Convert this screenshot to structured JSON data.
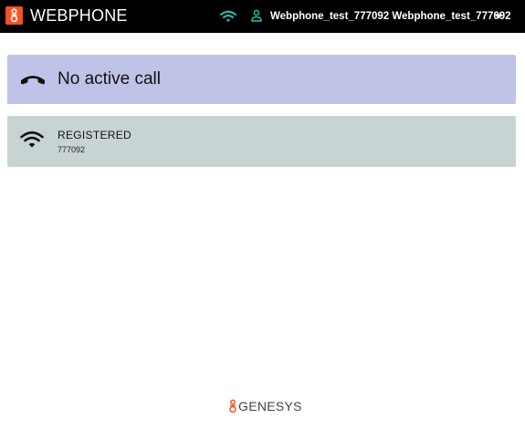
{
  "header": {
    "app_title": "WEBPHONE",
    "user_display": "Webphone_test_777092 Webphone_test_777092",
    "icons": [
      "genesys-logo-icon",
      "wifi-icon",
      "person-icon",
      "caret-down-icon"
    ],
    "colors": {
      "bar_bg": "#000000",
      "logo_bg": "#ff4f1f",
      "accent_teal": "#1ec8b4"
    }
  },
  "call_card": {
    "status": "No active call",
    "icon": "phone-hangup-icon",
    "color": "#c0c3e8"
  },
  "registration_card": {
    "status": "REGISTERED",
    "number": "777092",
    "icon": "wifi-icon",
    "color": "#c8d4d4"
  },
  "footer": {
    "brand": "GENESYS",
    "brand_color": "#ff4f1f"
  }
}
